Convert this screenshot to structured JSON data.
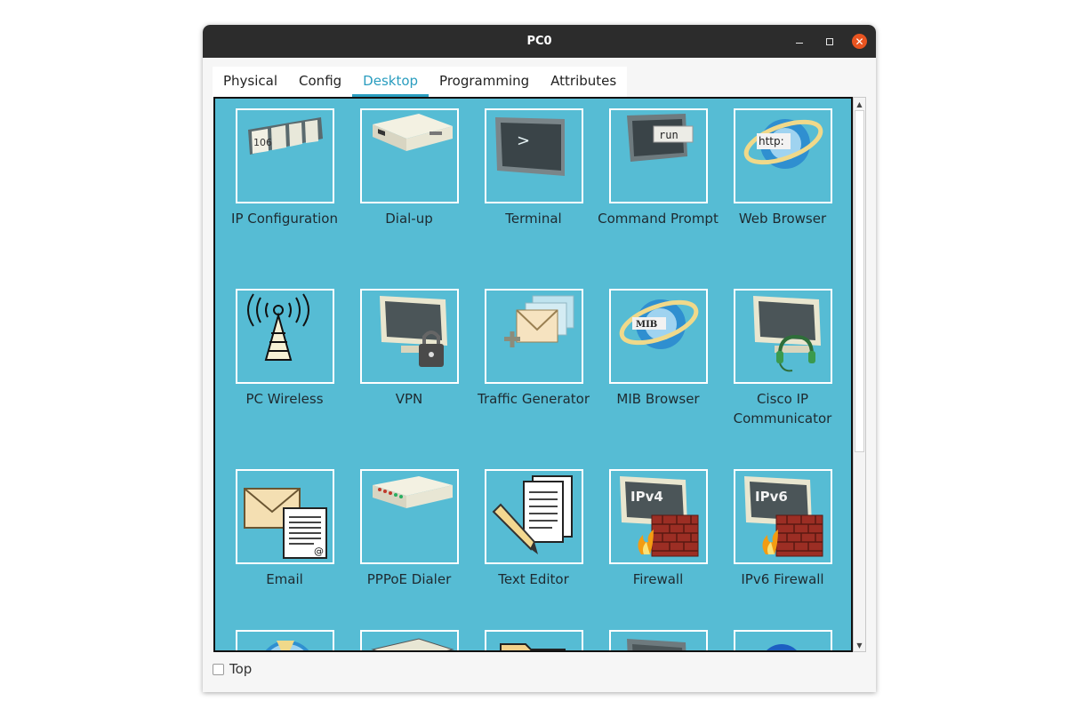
{
  "window": {
    "title": "PC0"
  },
  "tabs": [
    {
      "label": "Physical"
    },
    {
      "label": "Config"
    },
    {
      "label": "Desktop"
    },
    {
      "label": "Programming"
    },
    {
      "label": "Attributes"
    }
  ],
  "active_tab": "Desktop",
  "apps": [
    {
      "label": "IP Configuration",
      "icon": "ip-configuration-icon",
      "badge": "106"
    },
    {
      "label": "Dial-up",
      "icon": "modem-icon"
    },
    {
      "label": "Terminal",
      "icon": "terminal-icon",
      "badge": ">"
    },
    {
      "label": "Command Prompt",
      "icon": "command-prompt-icon",
      "badge": "run"
    },
    {
      "label": "Web Browser",
      "icon": "web-browser-icon",
      "badge": "http:"
    },
    {
      "label": "PC Wireless",
      "icon": "wireless-tower-icon"
    },
    {
      "label": "VPN",
      "icon": "vpn-lock-icon"
    },
    {
      "label": "Traffic Generator",
      "icon": "traffic-generator-icon"
    },
    {
      "label": "MIB Browser",
      "icon": "mib-browser-icon",
      "badge": "MIB"
    },
    {
      "label": "Cisco IP Communicator",
      "icon": "headset-monitor-icon"
    },
    {
      "label": "Email",
      "icon": "email-icon",
      "badge": "@"
    },
    {
      "label": "PPPoE Dialer",
      "icon": "pppoe-dialer-icon"
    },
    {
      "label": "Text Editor",
      "icon": "text-editor-icon"
    },
    {
      "label": "Firewall",
      "icon": "firewall-icon",
      "badge": "IPv4"
    },
    {
      "label": "IPv6 Firewall",
      "icon": "ipv6-firewall-icon",
      "badge": "IPv6"
    }
  ],
  "footer": {
    "top_label": "Top",
    "top_checked": false
  },
  "colors": {
    "panel": "#56bcd4",
    "accent": "#2a9dbf",
    "close": "#e95420"
  }
}
